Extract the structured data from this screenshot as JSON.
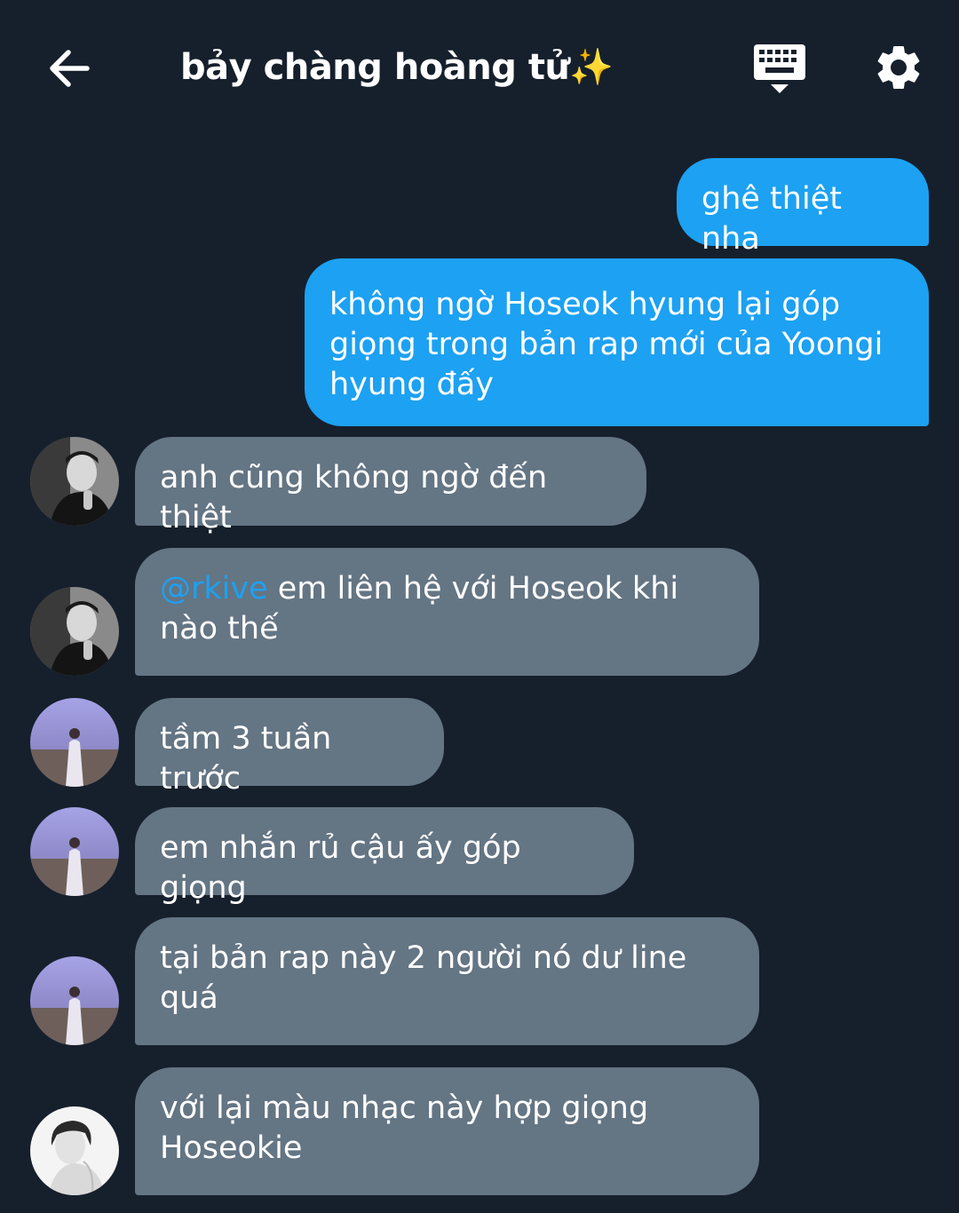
{
  "header": {
    "title": "bảy chàng hoàng tử✨",
    "icons": {
      "back": "arrow-left-icon",
      "keyboard": "keyboard-icon",
      "settings": "gear-icon"
    }
  },
  "colors": {
    "background": "#16202c",
    "outgoing_bubble": "#1da1f2",
    "incoming_bubble": "#647584",
    "mention": "#1da1f2"
  },
  "messages": [
    {
      "direction": "out",
      "text": "ghê thiệt nha"
    },
    {
      "direction": "out",
      "text": "không ngờ Hoseok hyung lại góp giọng trong bản rap mới của Yoongi hyung đấy"
    },
    {
      "direction": "in",
      "avatar": "avatar-black-and-white-portrait",
      "text": "anh cũng không ngờ đến thiệt"
    },
    {
      "direction": "in",
      "avatar": "avatar-black-and-white-portrait",
      "mention": "@rkive",
      "text": " em liên hệ với Hoseok khi nào thế"
    },
    {
      "direction": "in",
      "avatar": "avatar-purple-sky-figure",
      "text": "tầm 3 tuần trước"
    },
    {
      "direction": "in",
      "avatar": "avatar-purple-sky-figure",
      "text": "em nhắn rủ cậu ấy góp giọng"
    },
    {
      "direction": "in",
      "avatar": "avatar-purple-sky-figure",
      "text": "tại bản rap này 2 người nó dư line quá"
    },
    {
      "direction": "in",
      "avatar": "avatar-white-background-portrait",
      "text": "với lại màu nhạc này hợp giọng Hoseokie"
    }
  ]
}
